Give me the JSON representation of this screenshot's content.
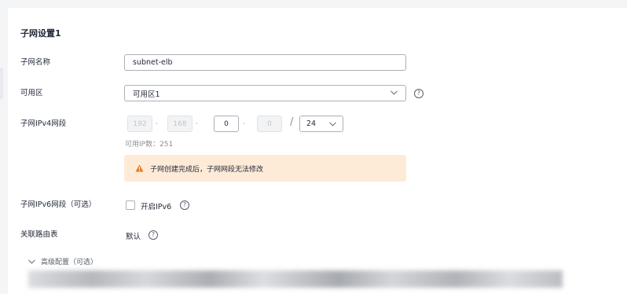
{
  "section_title": "子网设置1",
  "subnet_name": {
    "label": "子网名称",
    "value": "subnet-elb"
  },
  "az": {
    "label": "可用区",
    "value": "可用区1",
    "help": "?"
  },
  "ipv4": {
    "label": "子网IPv4网段",
    "octets": [
      "192",
      "168",
      "0",
      "0"
    ],
    "separator": "·",
    "slash": "/",
    "mask": "24",
    "available_ip": "可用IP数：251"
  },
  "warning": "子网创建完成后，子网网段无法修改",
  "ipv6": {
    "label": "子网IPv6网段（可选）",
    "checkbox_label": "开启IPv6",
    "checked": false,
    "help": "?"
  },
  "route_table": {
    "label": "关联路由表",
    "value": "默认",
    "help": "?"
  },
  "advanced": {
    "label": "高级配置（可选）",
    "icon": "chevron-down-icon"
  },
  "colors": {
    "warning_bg": "#fdebd8",
    "warning_icon": "#e37d29",
    "border": "#adb0b8"
  }
}
